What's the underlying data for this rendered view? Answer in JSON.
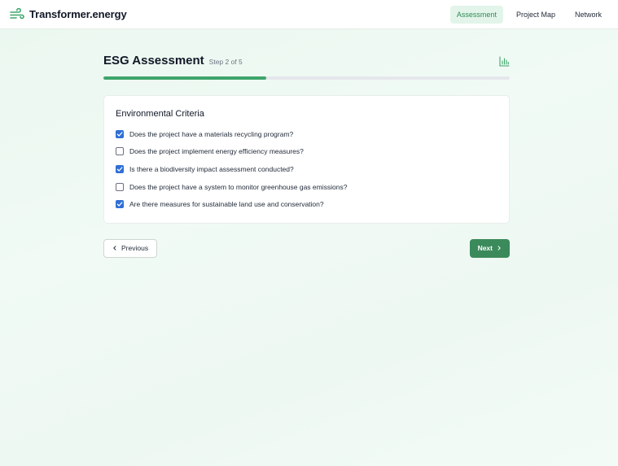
{
  "app": {
    "brand_name": "Transformer.energy",
    "brand_icon": "wind-icon",
    "accent_color": "#3fa56b"
  },
  "nav": {
    "items": [
      {
        "label": "Assessment",
        "active": true
      },
      {
        "label": "Project Map",
        "active": false
      },
      {
        "label": "Network",
        "active": false
      }
    ]
  },
  "assessment": {
    "title": "ESG Assessment",
    "step_label": "Step 2 of 5",
    "progress": 0.4,
    "chart_icon": "bar-chart-icon"
  },
  "criteria": {
    "section_title": "Environmental Criteria",
    "items": [
      {
        "label": "Does the project have a materials recycling program?",
        "checked": true
      },
      {
        "label": "Does the project implement energy efficiency measures?",
        "checked": false
      },
      {
        "label": "Is there a biodiversity impact assessment conducted?",
        "checked": true
      },
      {
        "label": "Does the project have a system to monitor greenhouse gas emissions?",
        "checked": false
      },
      {
        "label": "Are there measures for sustainable land use and conservation?",
        "checked": true
      }
    ]
  },
  "actions": {
    "previous_label": "Previous",
    "next_label": "Next"
  }
}
